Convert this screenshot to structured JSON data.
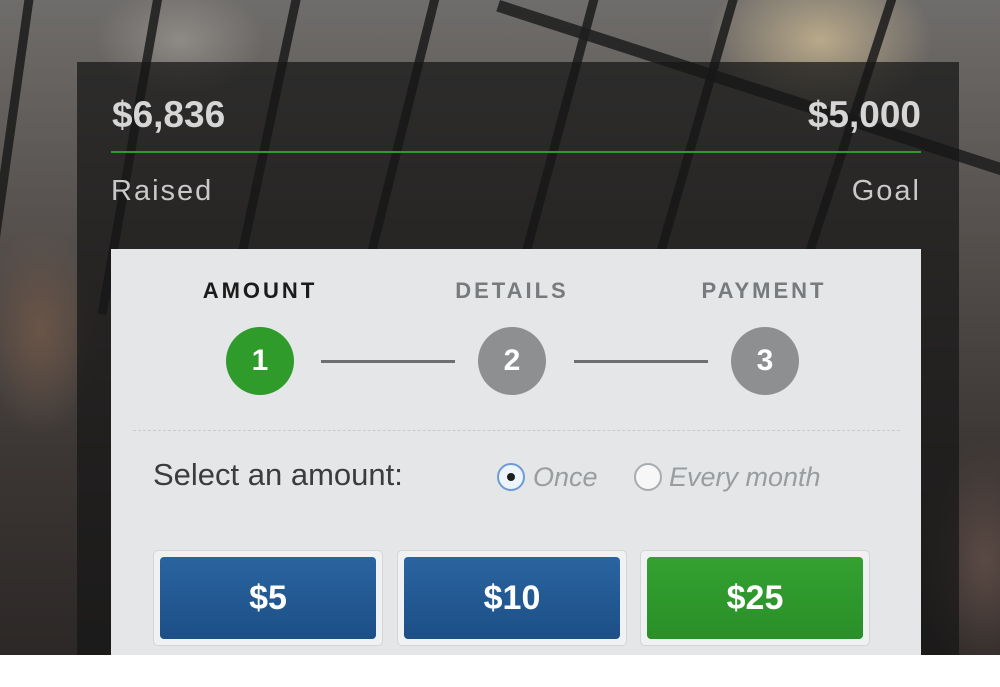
{
  "campaign": {
    "raised_amount": "$6,836",
    "raised_label": "Raised",
    "goal_amount": "$5,000",
    "goal_label": "Goal",
    "progress_fraction": 1.0
  },
  "steps": [
    {
      "number": "1",
      "label": "AMOUNT",
      "active": true
    },
    {
      "number": "2",
      "label": "DETAILS",
      "active": false
    },
    {
      "number": "3",
      "label": "PAYMENT",
      "active": false
    }
  ],
  "amount_form": {
    "select_label": "Select an amount:",
    "frequency_options": [
      {
        "label": "Once",
        "selected": true
      },
      {
        "label": "Every month",
        "selected": false
      }
    ],
    "amount_buttons": [
      {
        "label": "$5",
        "selected": false
      },
      {
        "label": "$10",
        "selected": false
      },
      {
        "label": "$25",
        "selected": true
      }
    ]
  },
  "colors": {
    "accent_green": "#2e9b2b",
    "button_blue": "#1c4f86",
    "inactive_step": "#8d8f91"
  }
}
